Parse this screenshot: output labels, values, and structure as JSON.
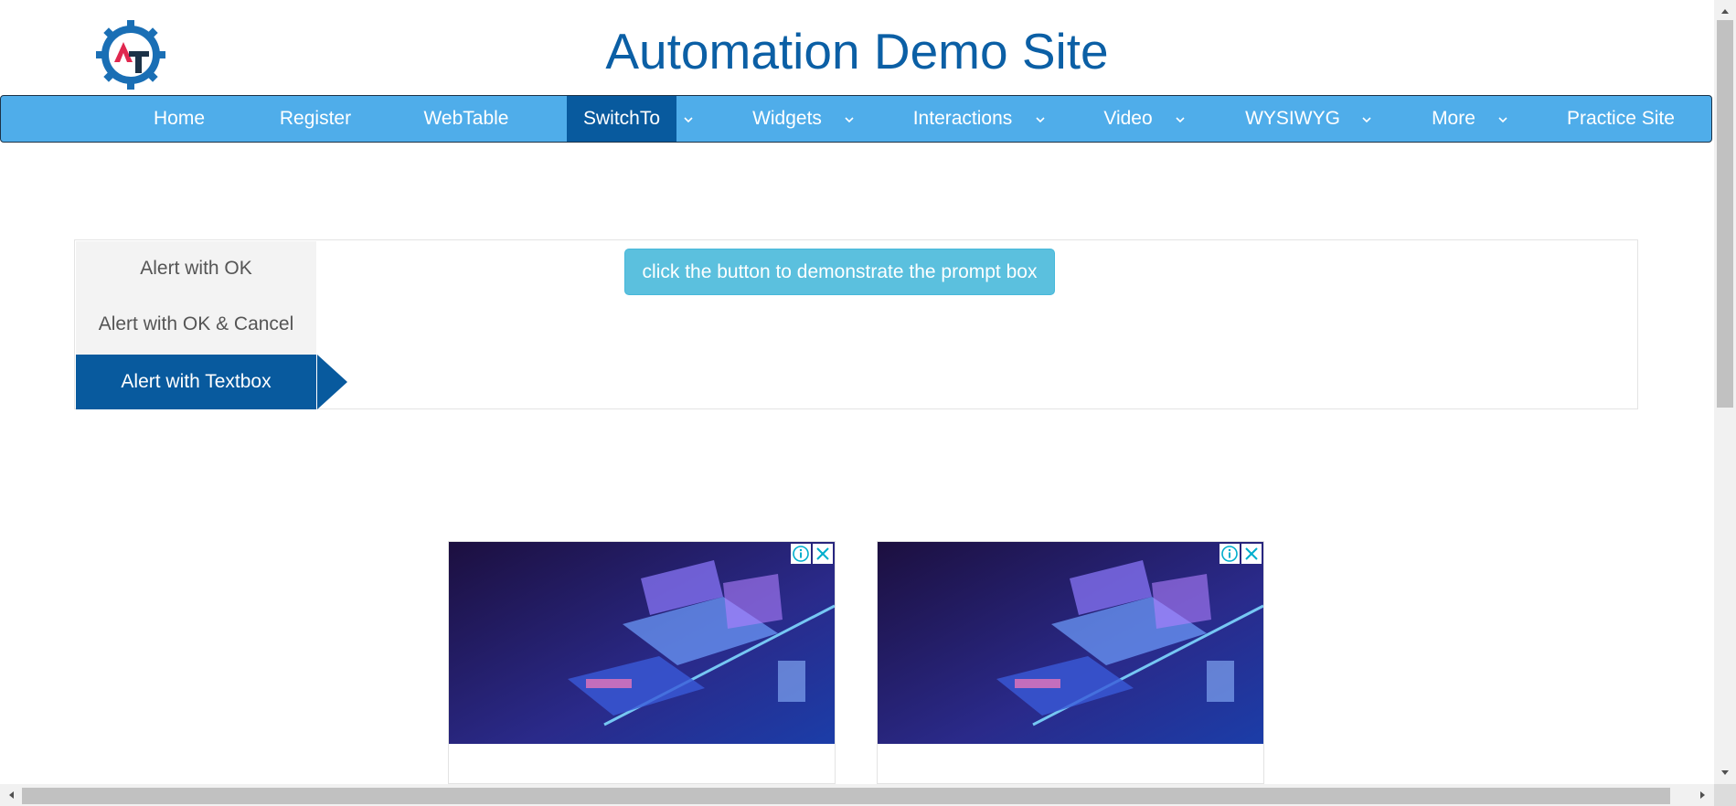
{
  "site": {
    "title": "Automation Demo Site",
    "logo_icon": "automation-testing-gear-logo-icon"
  },
  "nav": {
    "items": [
      {
        "label": "Home"
      },
      {
        "label": "Register"
      },
      {
        "label": "WebTable"
      },
      {
        "label": "SwitchTo",
        "active": true,
        "dropdown": true
      },
      {
        "label": "Widgets",
        "dropdown": true
      },
      {
        "label": "Interactions",
        "dropdown": true
      },
      {
        "label": "Video",
        "dropdown": true
      },
      {
        "label": "WYSIWYG",
        "dropdown": true
      },
      {
        "label": "More",
        "dropdown": true
      },
      {
        "label": "Practice Site"
      }
    ]
  },
  "alerts": {
    "tabs": [
      {
        "label": "Alert with OK"
      },
      {
        "label": "Alert with OK & Cancel"
      },
      {
        "label": "Alert with Textbox",
        "active": true
      }
    ],
    "button_label": "click the button to demonstrate the prompt box"
  },
  "ads": [
    {
      "info_icon": "info-icon",
      "close_icon": "close-icon"
    },
    {
      "info_icon": "info-icon",
      "close_icon": "close-icon"
    }
  ],
  "colors": {
    "brand_blue": "#0b5fa5",
    "nav_bg": "#4fadea",
    "nav_active": "#085a9e",
    "button_bg": "#5bc0de"
  }
}
